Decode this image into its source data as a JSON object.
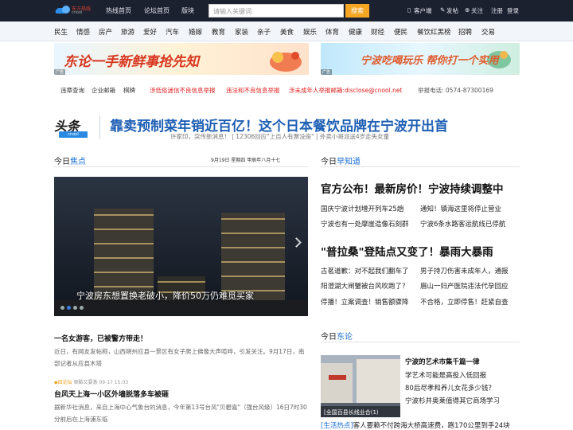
{
  "topbar": {
    "logo_text": "东方热线",
    "logo_sub": "cnool",
    "nav": [
      "热线首页",
      "论坛首页",
      "版块"
    ],
    "search_placeholder": "请输入关键词",
    "search_button": "搜索",
    "right": [
      "客户端",
      "发帖",
      "关注",
      "注册",
      "登录"
    ]
  },
  "categories": [
    "民生",
    "情感",
    "房产",
    "旅游",
    "爱好",
    "汽车",
    "婚嫁",
    "教育",
    "家装",
    "亲子",
    "美食",
    "娱乐",
    "体育",
    "健康",
    "财经",
    "便民",
    "餐饮红黑榜",
    "招聘",
    "交易"
  ],
  "banners": {
    "left_text": "东论一手新鲜事抢先知",
    "right_text": "宁波吃喝玩乐 帮你打一个实用",
    "ad_tag": "广告"
  },
  "notice": {
    "items": [
      "违章查询",
      "企业邮箱",
      "棋牌"
    ],
    "red_items": [
      "涉低俗迷信不良信息举报",
      "违法和不良信息举报",
      "涉未成年人举报邮箱:disclose@cnool.net"
    ],
    "phone": "举报电话: 0574-87300169"
  },
  "headline": {
    "logo_big": "头条",
    "logo_small": "cnool",
    "title": "靠卖预制菜年销近百亿！这个日本餐饮品牌在宁波开出首",
    "subtitle": "许家印，突传新消息！ | 12306回应\"上百人有票没座\" | 外卖小哥派送4岁走失女童"
  },
  "focus": {
    "label_a": "今日",
    "label_b": "焦点",
    "date": "9月19日 星期四 甲辰年八月十七",
    "caption": "宁波房东想置换老破小，降价50万仍难觅买家",
    "story1_title": "一名女游客，已被警方带走！",
    "story1_desc": "近日，有网友发帖称，山西朔州应县一景区有女子爬上佛像大声喧哗，引发关注。9月17日，南部记者从应县木塔",
    "meta_tag": "◆四论坛",
    "meta_rest": " 顿酷又要激 09-17 15:03",
    "story2_title": "台风天上海一小区外墙脱落多车被砸",
    "story2_desc": "据新华社消息，来自上海中心气象台的消息，今年第13号台风\"贝碧嘉\"（强台风级）16日7时30分前后在上海浦东临"
  },
  "know": {
    "label_a": "今日",
    "label_b": "早知道",
    "title1": "官方公布！最新房价！宁波持续调整中",
    "rows1": [
      [
        "国庆宁波计划增开列车25趟",
        "通知！镇海这里将停止营业"
      ],
      [
        "宁波也有一处摩崖造像石刻群",
        "宁波6条水路客运航线已停航"
      ]
    ],
    "title2": "\"普拉桑\"登陆点又变了！暴雨大暴雨",
    "rows2": [
      [
        "古茗道歉：对不起我们翻车了",
        "男子持刀伤害未成年人，通报"
      ],
      [
        "阳澄湖大闸蟹被台风吹跑了？",
        "眉山一妇产医院违法代孕回应"
      ],
      [
        "停播！立案调查！销售额骤降",
        "不合格，立即停售！赶紧自查"
      ]
    ]
  },
  "donglun": {
    "label_a": "今日",
    "label_b": "东论",
    "img_label": "[全国百县长线业合(1)",
    "title": "宁波的艺术市集千篇一律",
    "items": [
      "学艺术可能是高投入低回报",
      "80后尽孝和养儿女花多少钱？",
      "宁波杉井奥莱值得其它商场学习"
    ],
    "bottom_tag": "[生活热点]",
    "bottom_text": "客人要赖不付跨海大桥高速费，跑170公里到手24块"
  },
  "colors": {
    "accent": "#1a6fd4",
    "headline": "#1e5fb4",
    "alert": "#e02020",
    "search_btn": "#f5a623"
  }
}
